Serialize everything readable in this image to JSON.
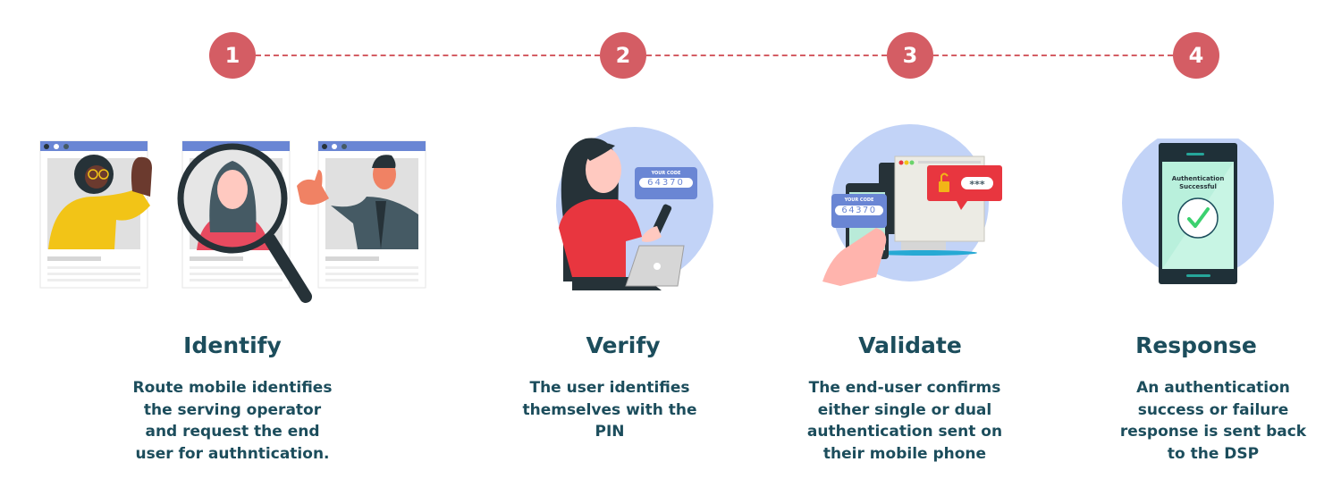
{
  "colors": {
    "accent": "#d45d64",
    "text": "#1c4d5c",
    "bubble_bg": "#c2d3f7",
    "window_bar": "#6a86d4"
  },
  "steps": [
    {
      "number": "1",
      "title": "Identify",
      "description": "Route mobile identifies the serving operator and request the end user for authntication.",
      "illustration": "profiles-magnifier"
    },
    {
      "number": "2",
      "title": "Verify",
      "description": "The user identifies themselves with the PIN",
      "illustration": "woman-phone-laptop",
      "code_label": "YOUR CODE",
      "code_value": "64370"
    },
    {
      "number": "3",
      "title": "Validate",
      "description": "The end-user confirms either single or dual authentication sent on their mobile phone",
      "illustration": "phone-desktop-lock",
      "code_label": "YOUR CODE",
      "code_value": "64370",
      "password_mask": "***"
    },
    {
      "number": "4",
      "title": "Response",
      "description": "An authentication success or failure response is sent back to the DSP",
      "illustration": "phone-success",
      "screen_text_line1": "Authentication",
      "screen_text_line2": "Successful"
    }
  ]
}
